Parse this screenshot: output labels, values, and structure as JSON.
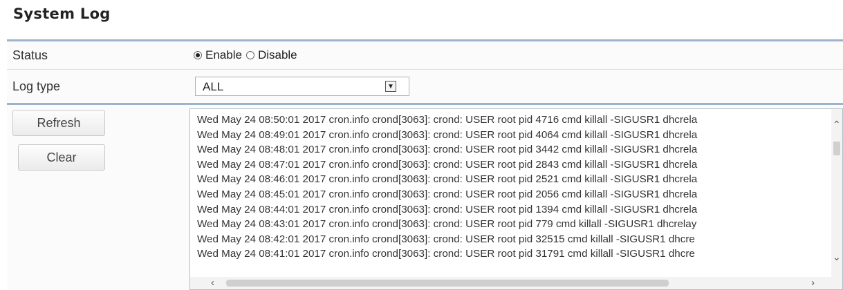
{
  "page_title": "System Log",
  "status": {
    "label": "Status",
    "options": [
      {
        "label": "Enable",
        "selected": true
      },
      {
        "label": "Disable",
        "selected": false
      }
    ]
  },
  "log_type": {
    "label": "Log type",
    "selected": "ALL"
  },
  "buttons": {
    "refresh": "Refresh",
    "clear": "Clear"
  },
  "log_lines": [
    "Wed May 24 08:50:01 2017 cron.info crond[3063]: crond: USER root pid 4716 cmd killall -SIGUSR1 dhcrela",
    "Wed May 24 08:49:01 2017 cron.info crond[3063]: crond: USER root pid 4064 cmd killall -SIGUSR1 dhcrela",
    "Wed May 24 08:48:01 2017 cron.info crond[3063]: crond: USER root pid 3442 cmd killall -SIGUSR1 dhcrela",
    "Wed May 24 08:47:01 2017 cron.info crond[3063]: crond: USER root pid 2843 cmd killall -SIGUSR1 dhcrela",
    "Wed May 24 08:46:01 2017 cron.info crond[3063]: crond: USER root pid 2521 cmd killall -SIGUSR1 dhcrela",
    "Wed May 24 08:45:01 2017 cron.info crond[3063]: crond: USER root pid 2056 cmd killall -SIGUSR1 dhcrela",
    "Wed May 24 08:44:01 2017 cron.info crond[3063]: crond: USER root pid 1394 cmd killall -SIGUSR1 dhcrela",
    "Wed May 24 08:43:01 2017 cron.info crond[3063]: crond: USER root pid 779 cmd killall -SIGUSR1 dhcrelay",
    "Wed May 24 08:42:01 2017 cron.info crond[3063]: crond: USER root pid 32515 cmd killall -SIGUSR1 dhcre",
    "Wed May 24 08:41:01 2017 cron.info crond[3063]: crond: USER root pid 31791 cmd killall -SIGUSR1 dhcre"
  ],
  "icons": {
    "select_arrow": "chevron-down-icon",
    "scroll_up": "chevron-up-icon",
    "scroll_down": "chevron-down-icon",
    "scroll_left": "chevron-left-icon",
    "scroll_right": "chevron-right-icon"
  },
  "colors": {
    "title_rule": "#9cb3cb",
    "row_background": "#fbfbfb"
  }
}
